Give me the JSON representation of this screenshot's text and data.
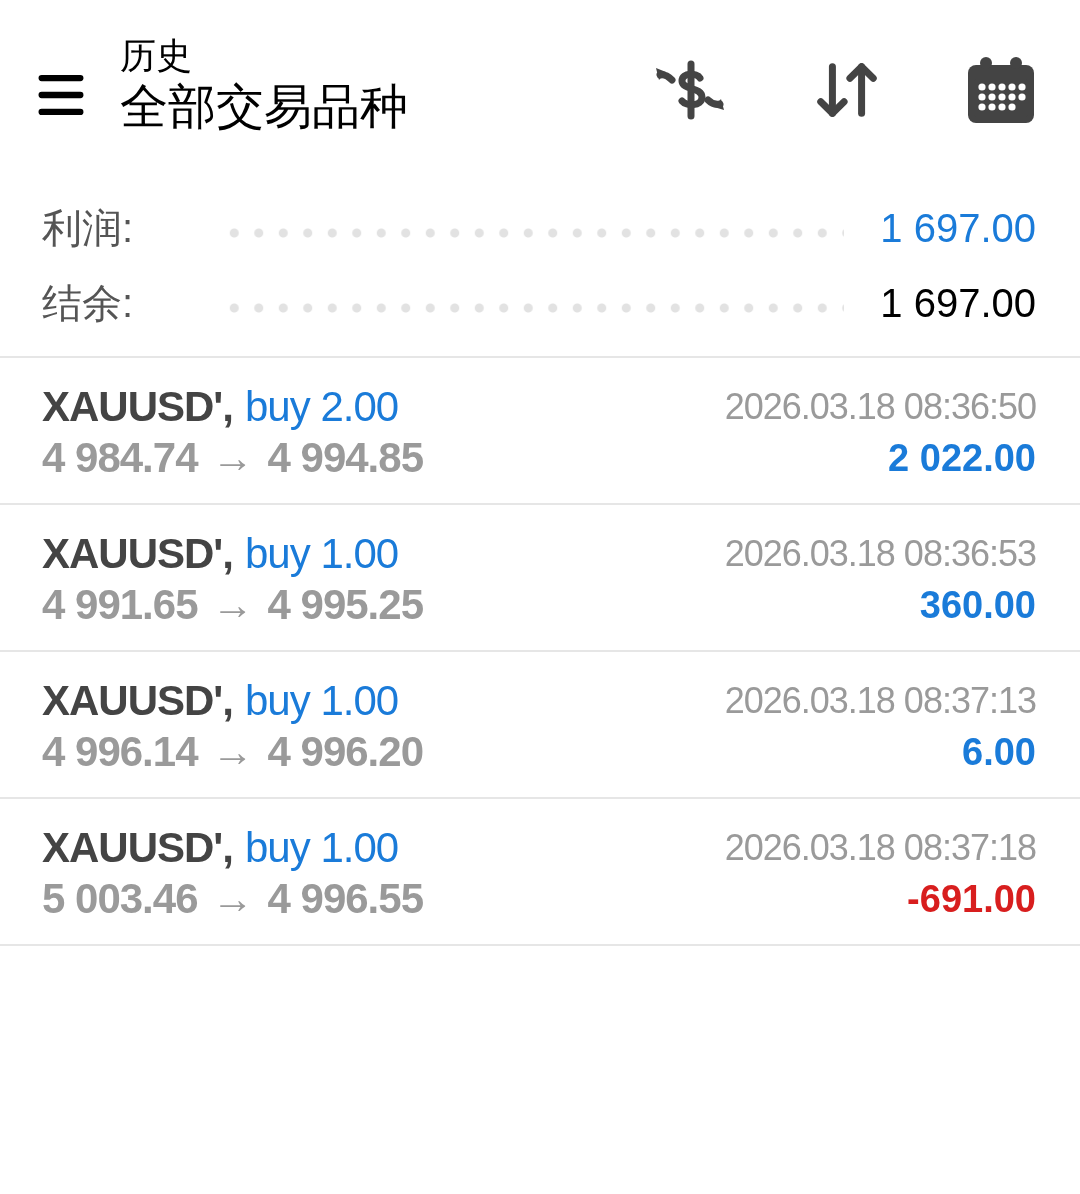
{
  "header": {
    "title": "历史",
    "subtitle": "全部交易品种"
  },
  "summary": [
    {
      "label": "利润:",
      "value": "1 697.00",
      "color": "#1a7bd9"
    },
    {
      "label": "结余:",
      "value": "1 697.00",
      "color": "#000000"
    }
  ],
  "trades": [
    {
      "symbol": "XAUUSD',",
      "deal": "buy 2.00",
      "open": "4 984.74",
      "arrow": "→",
      "close": "4 994.85",
      "time": "2026.03.18 08:36:50",
      "profit": "2 022.00",
      "color": "#1a7bd9"
    },
    {
      "symbol": "XAUUSD',",
      "deal": "buy 1.00",
      "open": "4 991.65",
      "arrow": "→",
      "close": "4 995.25",
      "time": "2026.03.18 08:36:53",
      "profit": "360.00",
      "color": "#1a7bd9"
    },
    {
      "symbol": "XAUUSD',",
      "deal": "buy 1.00",
      "open": "4 996.14",
      "arrow": "→",
      "close": "4 996.20",
      "time": "2026.03.18 08:37:13",
      "profit": "6.00",
      "color": "#1a7bd9"
    },
    {
      "symbol": "XAUUSD',",
      "deal": "buy 1.00",
      "open": "5 003.46",
      "arrow": "→",
      "close": "4 996.55",
      "time": "2026.03.18 08:37:18",
      "profit": "-691.00",
      "color": "#d81e1e"
    }
  ]
}
